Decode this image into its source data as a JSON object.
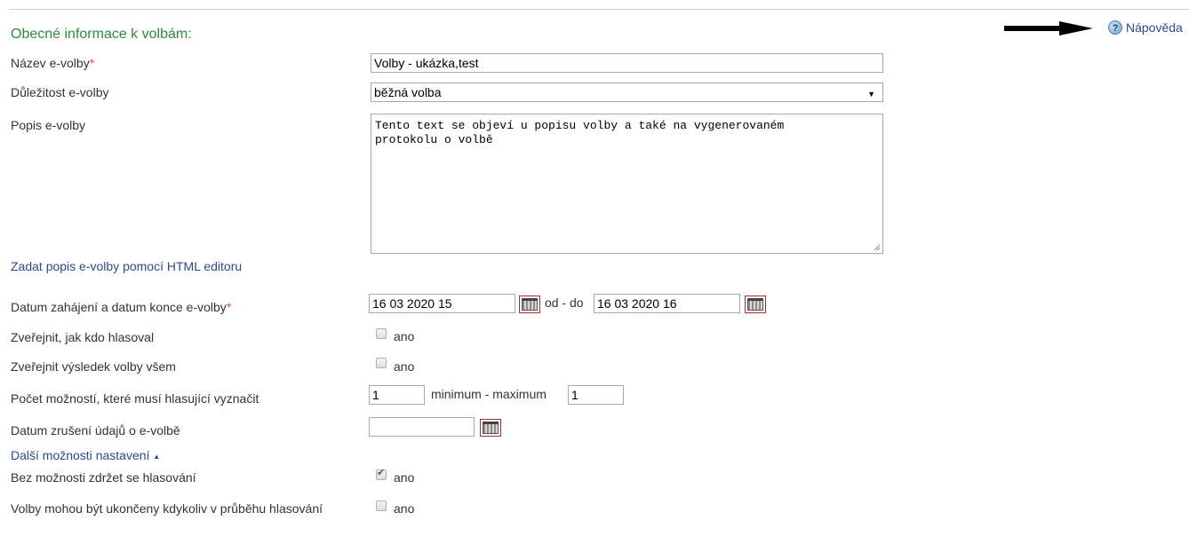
{
  "help": {
    "label": "Nápověda",
    "icon": "help-icon"
  },
  "section": {
    "title": "Obecné informace k volbám:"
  },
  "fields": {
    "name": {
      "label": "Název e-volby",
      "required_mark": "*",
      "value": "Volby - ukázka,test"
    },
    "importance": {
      "label": "Důležitost e-volby",
      "selected": "běžná volba"
    },
    "description": {
      "label": "Popis e-volby",
      "value": "Tento text se objeví u popisu volby a také na vygenerovaném\nprotokolu o volbě"
    },
    "html_editor_link": "Zadat popis e-volby pomocí HTML editoru",
    "dates": {
      "label": "Datum zahájení a datum konce e-volby",
      "required_mark": "*",
      "start": "16 03 2020 15",
      "separator": "od - do",
      "end": "16 03 2020 16"
    },
    "publish_who_voted": {
      "label": "Zveřejnit, jak kdo hlasoval",
      "option": "ano",
      "checked": false
    },
    "publish_result": {
      "label": "Zveřejnit výsledek volby všem",
      "option": "ano",
      "checked": false
    },
    "choices_count": {
      "label": "Počet možností, které musí hlasující vyznačit",
      "min": "1",
      "separator": "minimum - maximum",
      "max": "1"
    },
    "delete_date": {
      "label": "Datum zrušení údajů o e-volbě",
      "value": ""
    },
    "more_settings_link": "Další možnosti nastavení",
    "no_abstain": {
      "label": "Bez možnosti zdržet se hlasování",
      "option": "ano",
      "checked": true
    },
    "end_anytime": {
      "label": "Volby mohou být ukončeny kdykoliv v průběhu hlasování",
      "option": "ano",
      "checked": false
    }
  },
  "colors": {
    "title": "#2e8b3a",
    "link": "#2c4a8f",
    "required": "#d9534f"
  }
}
